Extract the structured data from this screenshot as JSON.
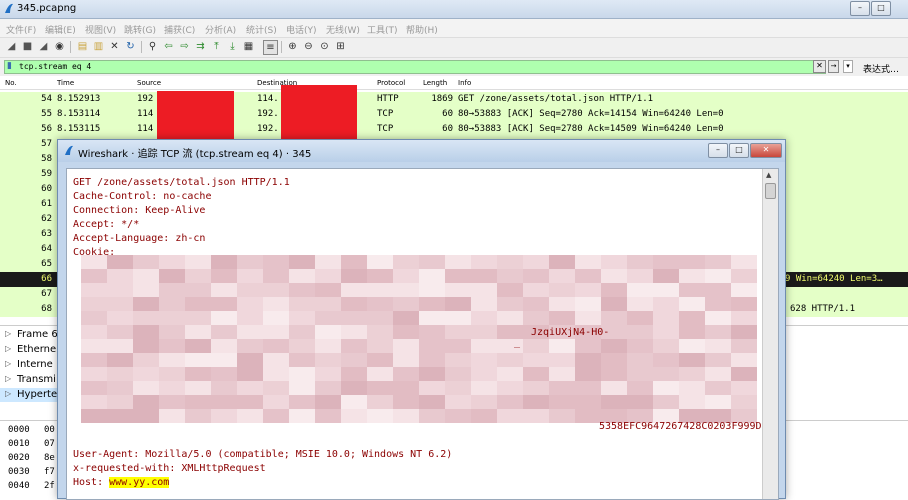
{
  "window": {
    "title": "345.pcapng",
    "min_label": "–",
    "max_label": "□",
    "close_label": "✕"
  },
  "menu": [
    "文件(F)",
    "编辑(E)",
    "视图(V)",
    "跳转(G)",
    "捕获(C)",
    "分析(A)",
    "统计(S)",
    "电话(Y)",
    "无线(W)",
    "工具(T)",
    "帮助(H)"
  ],
  "filter": {
    "value": "tcp.stream eq 4",
    "expression_label": "表达式…",
    "clear_label": "✕",
    "apply_label": "→",
    "dropdown_label": "▾"
  },
  "packet_list": {
    "columns": [
      "No.",
      "Time",
      "Source",
      "Destination",
      "Protocol",
      "Length",
      "Info"
    ],
    "rows": [
      {
        "no": "54",
        "time": "8.152913",
        "src": "192",
        "dst": "114.",
        "proto": "HTTP",
        "len": "1869",
        "info": "GET /zone/assets/total.json HTTP/1.1"
      },
      {
        "no": "55",
        "time": "8.153114",
        "src": "114",
        "dst": "192.",
        "proto": "TCP",
        "len": "60",
        "info": "80→53883 [ACK] Seq=2780 Ack=14154 Win=64240 Len=0"
      },
      {
        "no": "56",
        "time": "8.153115",
        "src": "114",
        "dst": "192.",
        "proto": "TCP",
        "len": "60",
        "info": "80→53883 [ACK] Seq=2780 Ack=14509 Win=64240 Len=0"
      },
      {
        "no": "57",
        "time": "",
        "src": "",
        "dst": "",
        "proto": "",
        "len": "",
        "info": ""
      },
      {
        "no": "58",
        "time": "",
        "src": "",
        "dst": "",
        "proto": "",
        "len": "",
        "info": ""
      },
      {
        "no": "59",
        "time": "",
        "src": "",
        "dst": "",
        "proto": "",
        "len": "",
        "info": ""
      },
      {
        "no": "60",
        "time": "",
        "src": "",
        "dst": "",
        "proto": "",
        "len": "",
        "info": ""
      },
      {
        "no": "61",
        "time": "",
        "src": "",
        "dst": "",
        "proto": "",
        "len": "",
        "info": ""
      },
      {
        "no": "62",
        "time": "",
        "src": "",
        "dst": "",
        "proto": "",
        "len": "",
        "info": ""
      },
      {
        "no": "63",
        "time": "",
        "src": "",
        "dst": "",
        "proto": "",
        "len": "",
        "info": ""
      },
      {
        "no": "64",
        "time": "",
        "src": "",
        "dst": "",
        "proto": "",
        "len": "",
        "info": ""
      },
      {
        "no": "65",
        "time": "",
        "src": "",
        "dst": "",
        "proto": "",
        "len": "",
        "info": ""
      },
      {
        "no": "66",
        "time": "",
        "src": "",
        "dst": "",
        "proto": "",
        "len": "",
        "info": "9 Win=64240 Len=3…"
      },
      {
        "no": "67",
        "time": "",
        "src": "",
        "dst": "",
        "proto": "",
        "len": "",
        "info": ""
      },
      {
        "no": "68",
        "time": "",
        "src": "",
        "dst": "",
        "proto": "",
        "len": "",
        "info": "628 HTTP/1.1"
      }
    ]
  },
  "details": [
    "Frame 6",
    "Etherne",
    "Interne",
    "Transmi",
    "Hypertex"
  ],
  "bytes": [
    {
      "offset": "0000",
      "hex": "00"
    },
    {
      "offset": "0010",
      "hex": "07"
    },
    {
      "offset": "0020",
      "hex": "8e"
    },
    {
      "offset": "0030",
      "hex": "f7"
    },
    {
      "offset": "0040",
      "hex": "2f"
    }
  ],
  "dialog": {
    "title": "Wireshark · 追踪 TCP 流 (tcp.stream eq 4) · 345",
    "min_label": "–",
    "max_label": "□",
    "close_label": "✕",
    "lines_top": [
      "GET /zone/assets/total.json HTTP/1.1",
      "Cache-Control: no-cache",
      "Connection: Keep-Alive",
      "Accept: */*",
      "Accept-Language: zh-cn",
      "Cookie:"
    ],
    "fragments": [
      "JzqiUXjN4-H0-",
      "_",
      "5358EFC9647267428C0203F999D"
    ],
    "lines_bottom": [
      "User-Agent: Mozilla/5.0 (compatible; MSIE 10.0; Windows NT 6.2)",
      "x-requested-with: XMLHttpRequest"
    ],
    "host_key": "Host: ",
    "host_value": "www.yy.com"
  },
  "colors": {
    "tcp_row": "#e4ffc7",
    "selected_row": "#1a1a1a",
    "selected_text": "#f3ff70",
    "filter_ok": "#afffaf",
    "stream_text": "#8b0000",
    "redaction": "#ed1c24",
    "host_highlight": "#ffff00"
  }
}
